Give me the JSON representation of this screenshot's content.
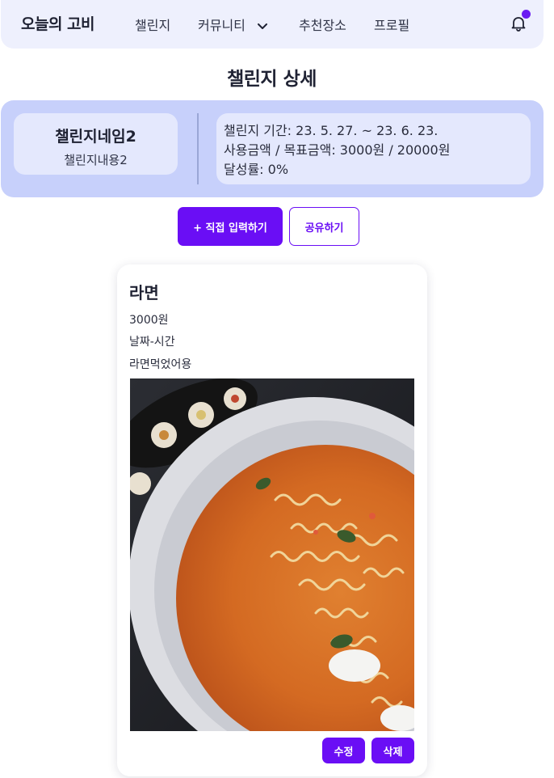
{
  "nav": {
    "brand": "오늘의 고비",
    "items": [
      "챌린지",
      "커뮤니티",
      "추천장소",
      "프로필"
    ],
    "bell_icon": "bell-icon",
    "dropdown_icon": "chevron-down-icon",
    "notification_dot_color": "#6a1bf2"
  },
  "page": {
    "title": "챌린지 상세"
  },
  "challenge": {
    "name": "챌린지네임2",
    "description": "챌린지내용2",
    "period": "챌린지 기간: 23. 5. 27. ~ 23. 6. 23.",
    "amounts": "사용금액 / 목표금액: 3000원 / 20000원",
    "achievement": "달성률: 0%"
  },
  "actions": {
    "add_label": "+ 직접 입력하기",
    "share_label": "공유하기"
  },
  "record": {
    "title": "라면",
    "amount": "3000원",
    "datetime": "날짜-시간",
    "memo": "라면먹었어용",
    "photo_icon": "ramen-photo",
    "edit_label": "수정",
    "delete_label": "삭제"
  },
  "colors": {
    "accent": "#6a0ef5",
    "nav_bg": "#eef0fd",
    "panel_bg": "#c7d0fb",
    "card_bg": "#e4e8fd"
  }
}
